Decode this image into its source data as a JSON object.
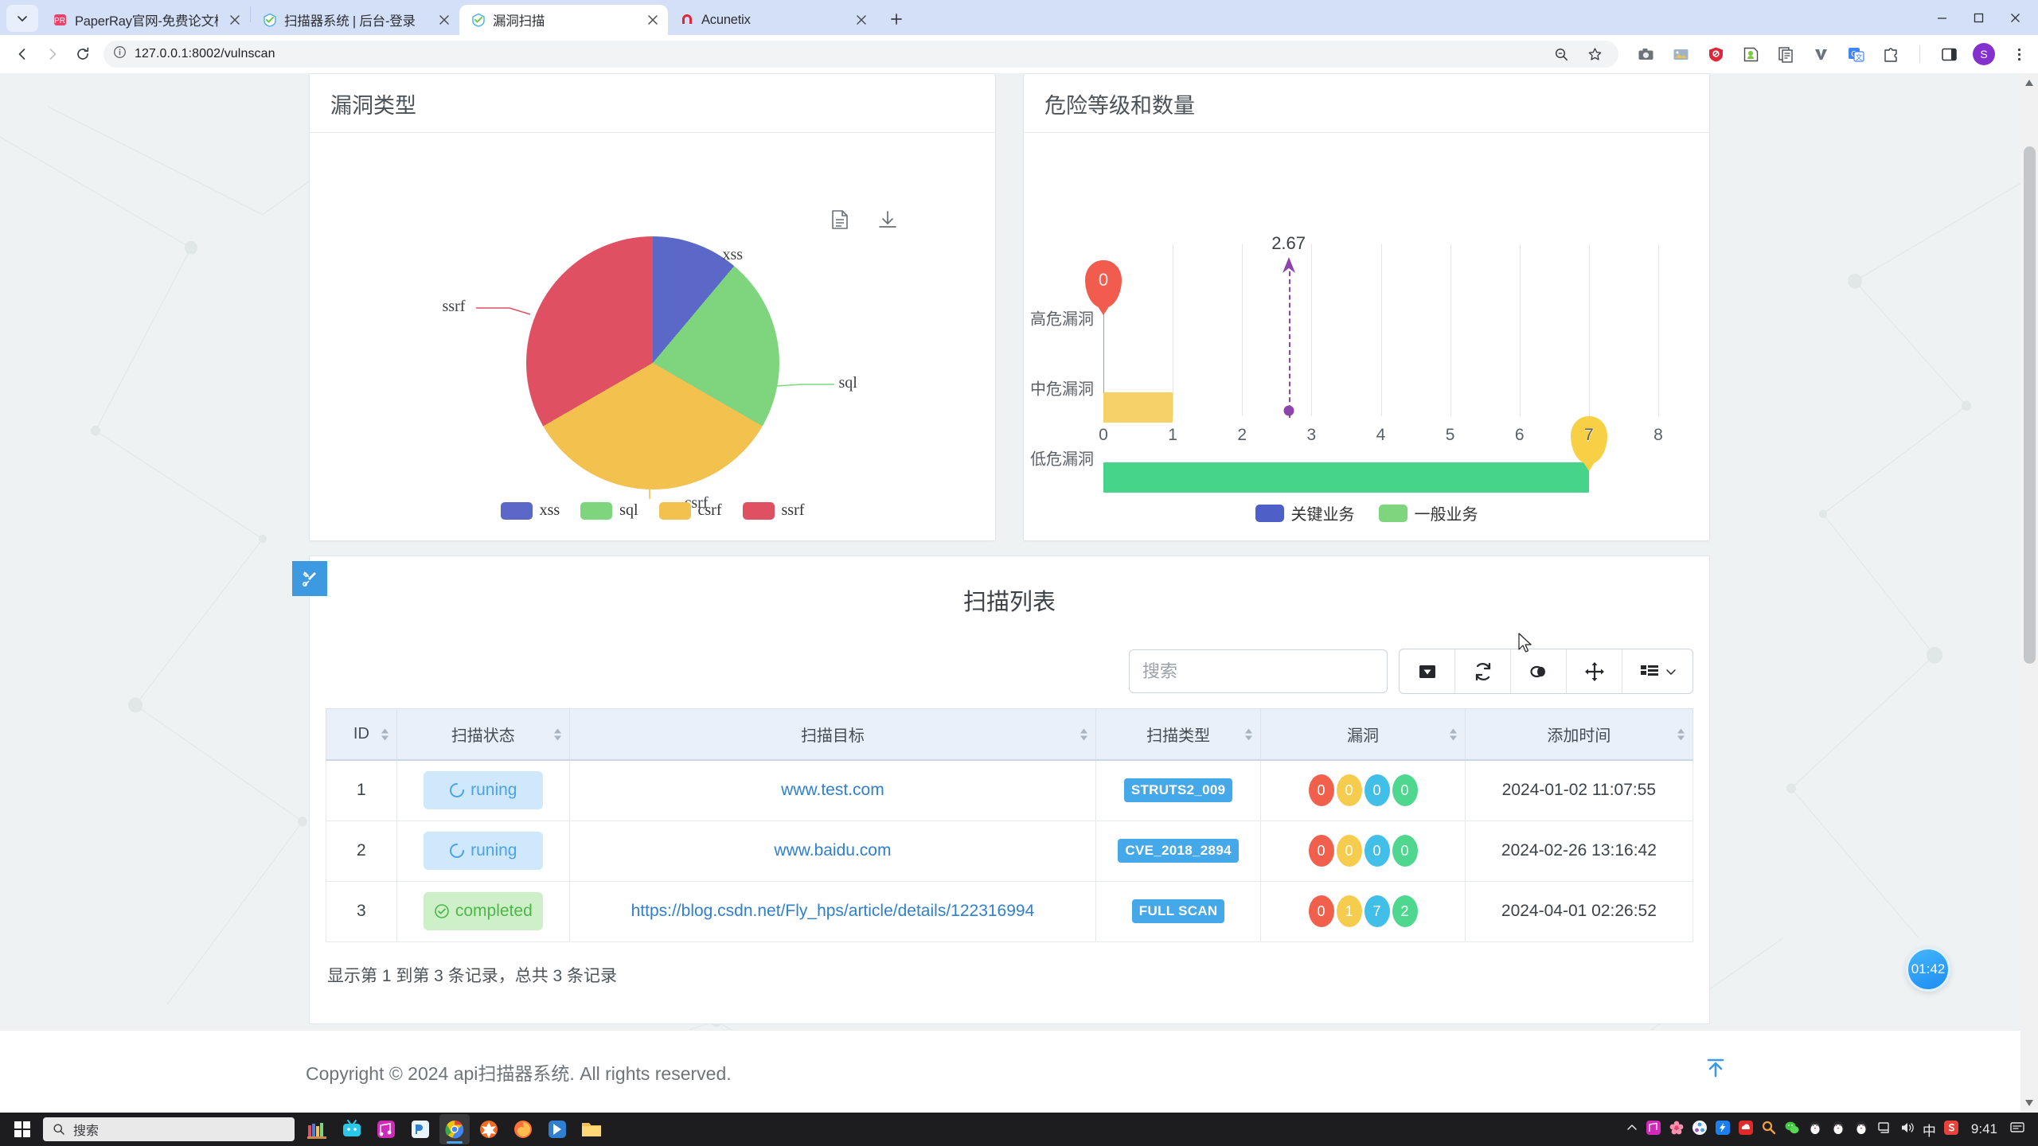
{
  "browser": {
    "tabs": [
      {
        "title": "PaperRay官网-免费论文检测服",
        "active": false,
        "favicon": "paperray-icon"
      },
      {
        "title": "扫描器系统 | 后台-登录",
        "active": false,
        "favicon": "scanner-icon"
      },
      {
        "title": "漏洞扫描",
        "active": true,
        "favicon": "scanner-icon"
      },
      {
        "title": "Acunetix",
        "active": false,
        "favicon": "acunetix-icon"
      }
    ],
    "new_tab_label": "+",
    "url": "127.0.0.1:8002/vulnscan",
    "nav": {
      "back": "←",
      "forward": "→",
      "reload": "⟳"
    },
    "profile_initial": "S",
    "window_controls": {
      "minimize": "—",
      "maximize": "▢",
      "close": "✕"
    }
  },
  "chart_data": [
    {
      "type": "pie",
      "title": "漏洞类型",
      "categories": [
        "xss",
        "sql",
        "csrf",
        "ssrf"
      ],
      "values": [
        1,
        2,
        3,
        3
      ],
      "percentages": [
        11.1,
        22.2,
        33.3,
        33.3
      ],
      "colors": [
        "#5b68c8",
        "#7ed57e",
        "#f2c14e",
        "#e05063"
      ],
      "legend": [
        "xss",
        "sql",
        "csrf",
        "ssrf"
      ],
      "legend_position": "bottom",
      "labels_outside": [
        "xss",
        "sql",
        "csrf",
        "ssrf"
      ]
    },
    {
      "type": "bar",
      "orientation": "horizontal",
      "title": "危险等级和数量",
      "categories": [
        "高危漏洞",
        "中危漏洞",
        "低危漏洞"
      ],
      "values": [
        0,
        1,
        7
      ],
      "bar_colors": [
        "#f2c14e",
        "#f2c14e",
        "#45d48a"
      ],
      "markers": [
        {
          "category": "高危漏洞",
          "value": 0,
          "label": "0",
          "color": "#f25c4e"
        },
        {
          "category": "低危漏洞",
          "value": 7,
          "label": "7",
          "color": "#f7d046"
        }
      ],
      "average_line": {
        "value": 2.67,
        "label": "2.67",
        "color": "#8e44ad"
      },
      "xlabel": "",
      "ylabel": "",
      "xticks": [
        0,
        1,
        2,
        3,
        4,
        5,
        6,
        7,
        8
      ],
      "xlim": [
        0,
        8
      ],
      "grid": true,
      "legend": [
        "关键业务",
        "一般业务"
      ],
      "legend_colors": [
        "#4e5fc8",
        "#7ed57e"
      ],
      "legend_position": "bottom"
    }
  ],
  "pie_card": {
    "title": "漏洞类型",
    "tools": {
      "data_view": "data-view-icon",
      "download": "download-icon"
    }
  },
  "bar_card": {
    "title": "危险等级和数量"
  },
  "scan_panel": {
    "title": "扫描列表",
    "sidebar_toggle_icon": "tools-icon",
    "search": {
      "placeholder": "搜索",
      "value": ""
    },
    "toolbar": [
      {
        "name": "export-button",
        "icon": "caret-down-square-icon"
      },
      {
        "name": "refresh-button",
        "icon": "refresh-icon"
      },
      {
        "name": "toggle-view-button",
        "icon": "toggle-circles-icon"
      },
      {
        "name": "fullscreen-button",
        "icon": "arrows-move-icon"
      },
      {
        "name": "columns-button",
        "icon": "columns-list-icon"
      }
    ],
    "columns": [
      "ID",
      "扫描状态",
      "扫描目标",
      "扫描类型",
      "漏洞",
      "添加时间"
    ],
    "rows": [
      {
        "id": "1",
        "status": "runing",
        "status_type": "running",
        "target": "www.test.com",
        "scan_type": "STRUTS2_009",
        "vulns": [
          {
            "label": "0",
            "color": "#f0604d"
          },
          {
            "label": "0",
            "color": "#f5cc4d"
          },
          {
            "label": "0",
            "color": "#41bfe8"
          },
          {
            "label": "0",
            "color": "#4fd68f"
          }
        ],
        "added_time": "2024-01-02 11:07:55"
      },
      {
        "id": "2",
        "status": "runing",
        "status_type": "running",
        "target": "www.baidu.com",
        "scan_type": "CVE_2018_2894",
        "vulns": [
          {
            "label": "0",
            "color": "#f0604d"
          },
          {
            "label": "0",
            "color": "#f5cc4d"
          },
          {
            "label": "0",
            "color": "#41bfe8"
          },
          {
            "label": "0",
            "color": "#4fd68f"
          }
        ],
        "added_time": "2024-02-26 13:16:42"
      },
      {
        "id": "3",
        "status": "completed",
        "status_type": "completed",
        "target": "https://blog.csdn.net/Fly_hps/article/details/122316994",
        "scan_type": "FULL SCAN",
        "vulns": [
          {
            "label": "0",
            "color": "#f0604d"
          },
          {
            "label": "1",
            "color": "#f5cc4d"
          },
          {
            "label": "7",
            "color": "#41bfe8"
          },
          {
            "label": "2",
            "color": "#4fd68f"
          }
        ],
        "added_time": "2024-04-01 02:26:52"
      }
    ],
    "info": "显示第 1 到第 3 条记录，总共 3 条记录"
  },
  "footer": {
    "copyright": "Copyright © 2024 api扫描器系统. All rights reserved.",
    "back_to_top_icon": "back-to-top-icon"
  },
  "float_widget": {
    "clock": "01:42"
  },
  "taskbar": {
    "search_placeholder": "搜索",
    "clock": "9:41",
    "lang": "中"
  }
}
